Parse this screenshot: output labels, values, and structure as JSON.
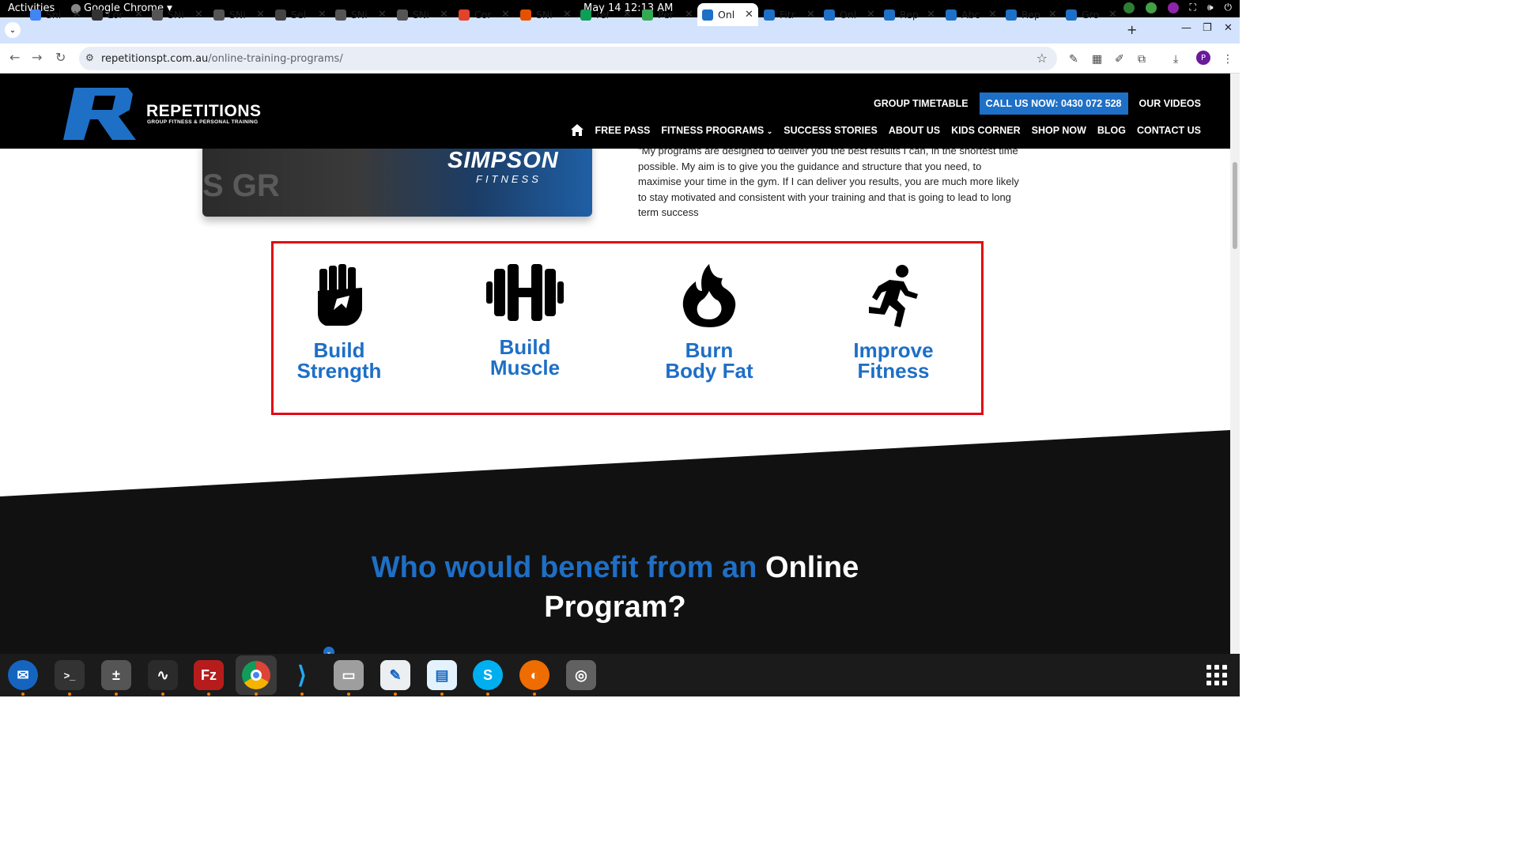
{
  "system": {
    "activities": "Activities",
    "app_name": "Google Chrome",
    "clock": "May 14  12:13 AM"
  },
  "browser": {
    "tabs": [
      {
        "title": "Sni",
        "icon": "docs-icon",
        "color": "#4285f4"
      },
      {
        "title": "Lor",
        "icon": "lorem-icon",
        "color": "#333333"
      },
      {
        "title": "SNi",
        "icon": "snp-icon",
        "color": "#555555"
      },
      {
        "title": "SNi",
        "icon": "snp-icon",
        "color": "#555555"
      },
      {
        "title": "Sel",
        "icon": "globe-icon",
        "color": "#444444"
      },
      {
        "title": "SNi",
        "icon": "snp-icon",
        "color": "#555555"
      },
      {
        "title": "SNi",
        "icon": "snp-icon",
        "color": "#555555"
      },
      {
        "title": "Cor",
        "icon": "gitlab-icon",
        "color": "#e24329"
      },
      {
        "title": "SNi",
        "icon": "colorful-icon",
        "color": "#e65100"
      },
      {
        "title": "ref",
        "icon": "sheets-icon",
        "color": "#0f9d58"
      },
      {
        "title": "Per",
        "icon": "leaf-icon",
        "color": "#34a853"
      },
      {
        "title": "Onl",
        "icon": "site-icon",
        "color": "#1e6fc6",
        "active": true
      },
      {
        "title": "Fitr",
        "icon": "site-icon",
        "color": "#1e6fc6"
      },
      {
        "title": "Onl",
        "icon": "site-icon",
        "color": "#1e6fc6"
      },
      {
        "title": "Rep",
        "icon": "site-icon",
        "color": "#1e6fc6"
      },
      {
        "title": "Abc",
        "icon": "site-icon",
        "color": "#1e6fc6"
      },
      {
        "title": "Rep",
        "icon": "site-icon",
        "color": "#1e6fc6"
      },
      {
        "title": "Gro",
        "icon": "site-icon",
        "color": "#1e6fc6"
      }
    ],
    "url_domain": "repetitionspt.com.au",
    "url_path": "/online-training-programs/",
    "profile_initial": "P"
  },
  "site": {
    "logo_name": "REPETITIONS",
    "logo_tagline": "GROUP FITNESS & PERSONAL TRAINING",
    "top_links": {
      "timetable": "GROUP TIMETABLE",
      "call": "CALL US NOW: 0430 072 528",
      "videos": "OUR VIDEOS"
    },
    "nav": [
      "FREE PASS",
      "FITNESS PROGRAMS",
      "SUCCESS STORIES",
      "ABOUT US",
      "KIDS CORNER",
      "SHOP NOW",
      "BLOG",
      "CONTACT US"
    ],
    "hero_brand": "SIMPSON",
    "hero_brand_sub": "FITNESS",
    "hero_ghost_text": "S GR",
    "intro_text": "\"My programs are designed to deliver you the best results I can, in the shortest time possible. My aim is to give you the guidance and structure that you need, to maximise your time in the gym. If I can deliver you results, you are much more likely to stay motivated and consistent with your training and that is going to lead to long term success",
    "benefits": [
      {
        "line1": "Build",
        "line2": "Strength",
        "icon": "fist-icon"
      },
      {
        "line1": "Build",
        "line2": "Muscle",
        "icon": "dumbbell-icon"
      },
      {
        "line1": "Burn",
        "line2": "Body Fat",
        "icon": "flame-icon"
      },
      {
        "line1": "Improve",
        "line2": "Fitness",
        "icon": "running-icon"
      }
    ],
    "headline_blue": "Who would benefit from an",
    "headline_white1": "Online",
    "headline_white2": "Program?",
    "accent_color": "#1e6fc6",
    "highlight_border_color": "#e30613"
  }
}
